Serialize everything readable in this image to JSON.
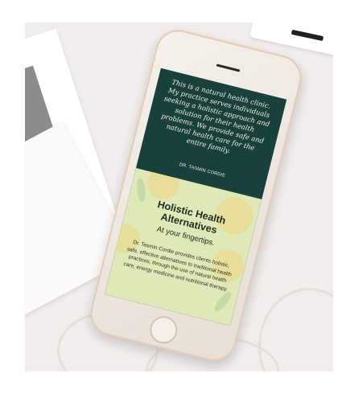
{
  "screen": {
    "quote": {
      "text": "This is a natural health clinic. My practice serves individuals seeking a holistic approach and solution for their health problems. We provide safe and natural health care for the entire family.",
      "author": "DR. TASMIN CORDIE"
    },
    "promo": {
      "title": "Holistic Health Alternatives",
      "subtitle": "At your fingertips.",
      "body": "Dr. Tasmin Cordie provides clients holistic, safe, effective alternatives to traditional health practices, through the use of natural health care, energy medicine and nutritional therapy."
    }
  },
  "colors": {
    "quote_background": "#17413a",
    "promo_background": "#dfe9b8",
    "desk": "#f1edec"
  }
}
